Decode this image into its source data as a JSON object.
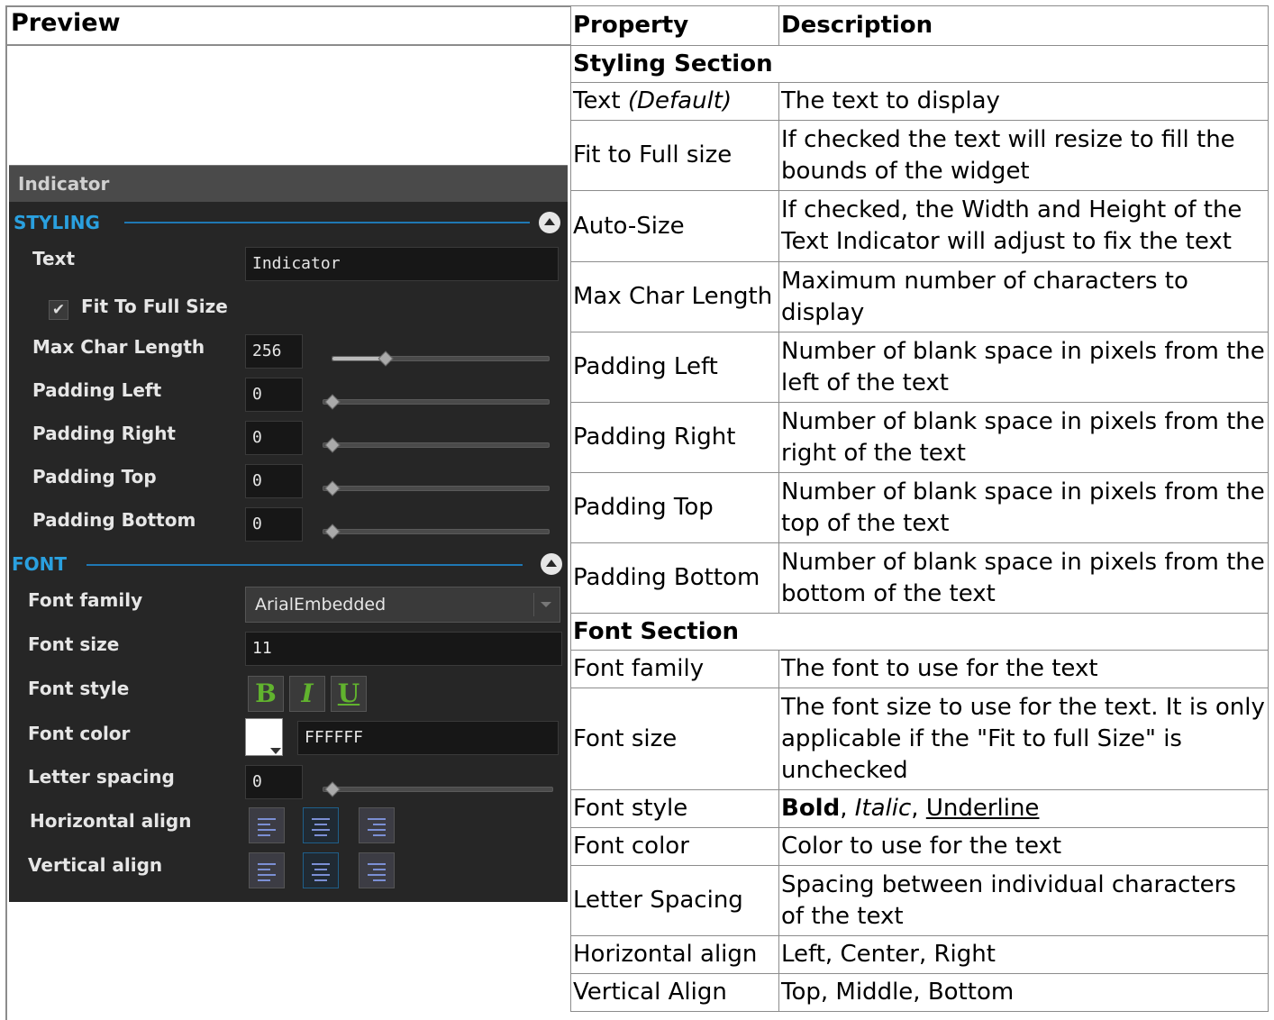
{
  "left_header": "Preview",
  "table": {
    "headers": [
      "Property",
      "Description"
    ],
    "styling_section": "Styling Section",
    "font_section": "Font Section",
    "styling_rows": [
      {
        "prop": "Text",
        "prop_em": "(Default)",
        "desc": "The text to display"
      },
      {
        "prop": "Fit to Full size",
        "desc": "If checked the text will resize to fill the bounds of the widget"
      },
      {
        "prop": "Auto-Size",
        "desc": "If checked, the Width and Height of the Text Indicator will adjust to fix the text"
      },
      {
        "prop": "Max Char Length",
        "desc": "Maximum number of characters to display"
      },
      {
        "prop": "Padding Left",
        "desc": "Number of blank space in pixels from the left of the text"
      },
      {
        "prop": "Padding Right",
        "desc": "Number of blank space in pixels from the right of the text"
      },
      {
        "prop": "Padding Top",
        "desc": "Number of blank space in pixels from the top of the text"
      },
      {
        "prop": "Padding Bottom",
        "desc": "Number of blank space in pixels from the bottom of the text"
      }
    ],
    "font_rows": [
      {
        "prop": "Font family",
        "desc": "The font to use for the text"
      },
      {
        "prop": "Font size",
        "desc": "The font size to use for the text. It is only applicable if the \"Fit to full Size\" is unchecked"
      },
      {
        "prop": "Font style",
        "desc_bold": "Bold",
        "desc_italic": "Italic",
        "desc_underline": "Underline",
        "sep": ", "
      },
      {
        "prop": "Font color",
        "desc": "Color to use for the text"
      },
      {
        "prop": "Letter Spacing",
        "desc": "Spacing between individual characters of the text"
      },
      {
        "prop": "Horizontal align",
        "desc": "Left, Center, Right"
      },
      {
        "prop": "Vertical Align",
        "desc": "Top, Middle, Bottom"
      }
    ]
  },
  "panel": {
    "title": "Indicator",
    "styling_header": "STYLING",
    "font_header": "FONT",
    "text_label": "Text",
    "text_value": "Indicator",
    "fit_label": "Fit To Full Size",
    "fit_checked": true,
    "max_label": "Max Char Length",
    "max_value": "256",
    "max_level": 0.22,
    "pad_left_label": "Padding Left",
    "pad_left_value": "0",
    "pad_right_label": "Padding Right",
    "pad_right_value": "0",
    "pad_top_label": "Padding Top",
    "pad_top_value": "0",
    "pad_bottom_label": "Padding Bottom",
    "pad_bottom_value": "0",
    "font_family_label": "Font family",
    "font_family_value": "ArialEmbedded",
    "font_size_label": "Font size",
    "font_size_value": "11",
    "font_style_label": "Font style",
    "bold_glyph": "B",
    "italic_glyph": "I",
    "underline_glyph": "U",
    "font_color_label": "Font color",
    "font_color_value": "FFFFFF",
    "letter_spacing_label": "Letter spacing",
    "letter_spacing_value": "0",
    "halign_label": "Horizontal align",
    "valign_label": "Vertical align",
    "colors": {
      "accent": "#2aa0df",
      "style_green": "#61b32e",
      "panel_bg": "#262626"
    }
  }
}
